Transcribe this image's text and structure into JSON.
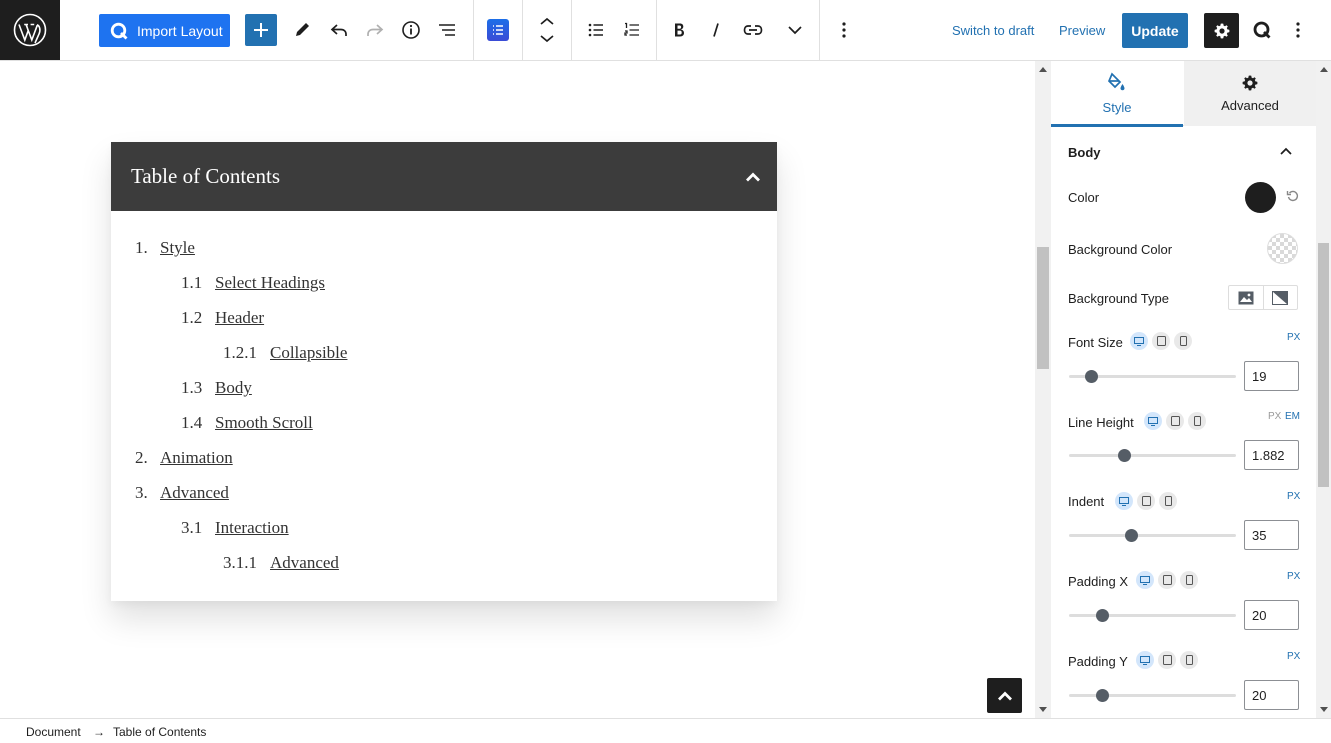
{
  "toolbar": {
    "import_layout_label": "Import Layout",
    "switch_to_draft": "Switch to draft",
    "preview": "Preview",
    "update": "Update"
  },
  "toc": {
    "title": "Table of Contents",
    "items": [
      {
        "num": "1.",
        "label": "Style",
        "level": 1
      },
      {
        "num": "1.1",
        "label": "Select Headings",
        "level": 2
      },
      {
        "num": "1.2",
        "label": "Header",
        "level": 2
      },
      {
        "num": "1.2.1",
        "label": "Collapsible",
        "level": 3
      },
      {
        "num": "1.3",
        "label": "Body",
        "level": 2
      },
      {
        "num": "1.4",
        "label": "Smooth Scroll",
        "level": 2
      },
      {
        "num": "2.",
        "label": "Animation",
        "level": 1
      },
      {
        "num": "3.",
        "label": "Advanced",
        "level": 1
      },
      {
        "num": "3.1",
        "label": "Interaction",
        "level": 2
      },
      {
        "num": "3.1.1",
        "label": "Advanced",
        "level": 3
      }
    ]
  },
  "sidebar": {
    "tabs": {
      "style": "Style",
      "advanced": "Advanced"
    },
    "panel_title": "Body",
    "color_label": "Color",
    "color_value": "#1e1e1e",
    "background_color_label": "Background Color",
    "background_type_label": "Background Type",
    "font_size": {
      "label": "Font Size",
      "unit": "PX",
      "value": "19",
      "level": 0.13
    },
    "line_height": {
      "label": "Line Height",
      "unit_px": "PX",
      "unit_em": "EM",
      "value": "1.882",
      "level": 0.33
    },
    "indent": {
      "label": "Indent",
      "unit": "PX",
      "value": "35",
      "level": 0.37
    },
    "padding_x": {
      "label": "Padding X",
      "unit": "PX",
      "value": "20",
      "level": 0.2
    },
    "padding_y": {
      "label": "Padding Y",
      "unit": "PX",
      "value": "20",
      "level": 0.2
    }
  },
  "breadcrumb": {
    "root": "Document",
    "arrow": "→",
    "current": "Table of Contents"
  },
  "colors": {
    "accent": "#2271b1",
    "import_button": "#1e73f0",
    "toc_header": "#3c3c3c"
  }
}
